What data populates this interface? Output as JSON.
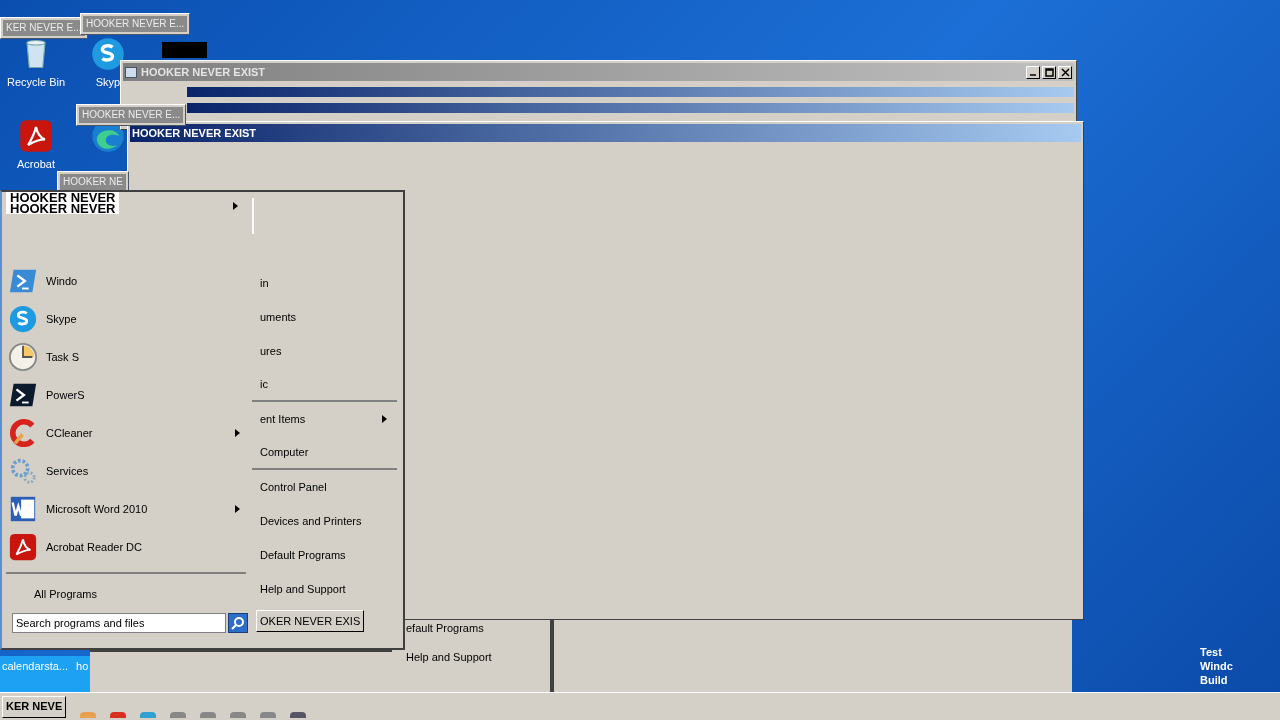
{
  "desktop_icons": [
    {
      "label": "Recycle Bin",
      "kind": "bin"
    },
    {
      "label": "Skyp",
      "kind": "skype"
    },
    {
      "label": "Acrobat",
      "kind": "acrobat"
    },
    {
      "kind": "edge"
    }
  ],
  "bottom_labels": [
    "calendarsta...",
    "ho"
  ],
  "mini_windows": [
    {
      "title": "KER NEVER E..."
    },
    {
      "title": "HOOKER NEVER E..."
    },
    {
      "title": "HOOKER NEVER E..."
    },
    {
      "title": "HOOKER NE"
    }
  ],
  "windows": [
    {
      "title": "HOOKER NEVER EXIST",
      "active": false
    },
    {
      "title": "HOOKER NEVER EXIST",
      "active": true
    }
  ],
  "start_menu": {
    "banner": [
      "HOOKER NEVER",
      "HOOKER NEVER"
    ],
    "programs": [
      {
        "label": "Windo",
        "submenu": false
      },
      {
        "label": "Skype",
        "submenu": false
      },
      {
        "label": "Task S",
        "submenu": false
      },
      {
        "label": "PowerS",
        "submenu": false
      },
      {
        "label": "CCleaner",
        "submenu": true
      },
      {
        "label": "Services",
        "submenu": false
      },
      {
        "label": "Microsoft Word 2010",
        "submenu": true
      },
      {
        "label": "Acrobat Reader DC",
        "submenu": false
      }
    ],
    "all_programs": "All Programs",
    "search": {
      "placeholder": "Search programs and files"
    },
    "places": [
      {
        "label": "in",
        "submenu": false,
        "divider": false
      },
      {
        "label": "uments",
        "submenu": false,
        "divider": false
      },
      {
        "label": "ures",
        "submenu": false,
        "divider": false
      },
      {
        "label": "ic",
        "submenu": false,
        "divider": true
      },
      {
        "label": "ent Items",
        "submenu": true,
        "divider": false
      },
      {
        "label": "Computer",
        "submenu": false,
        "divider": true
      },
      {
        "label": "Control Panel",
        "submenu": false,
        "divider": false
      },
      {
        "label": "Devices and Printers",
        "submenu": false,
        "divider": false
      },
      {
        "label": "Default Programs",
        "submenu": false,
        "divider": false
      },
      {
        "label": "Help and Support",
        "submenu": false,
        "divider": false
      }
    ],
    "shutdown": "OKER NEVER EXIS"
  },
  "ghost_items": [
    "efault Programs",
    "Help and Support"
  ],
  "taskbar": {
    "button": "KER NEVE"
  },
  "watermark_text": [
    "Test",
    "Windc",
    "Build"
  ]
}
